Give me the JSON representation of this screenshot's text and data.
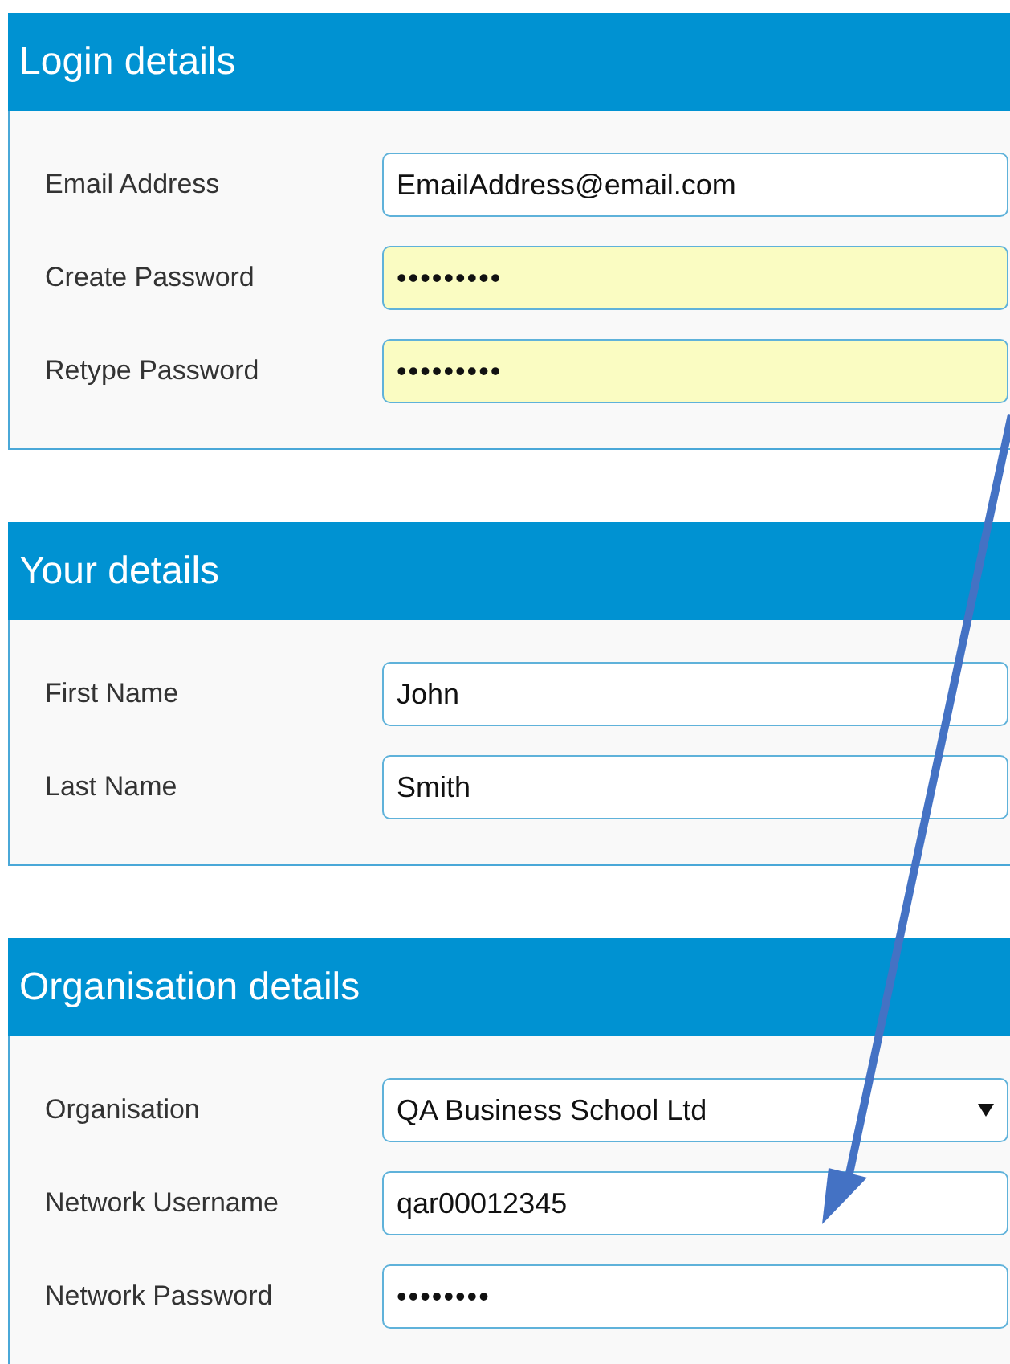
{
  "sections": [
    {
      "title": "Login details",
      "fields": [
        {
          "label": "Email Address",
          "kind": "text",
          "value": "EmailAddress@email.com",
          "autofilled": false
        },
        {
          "label": "Create Password",
          "kind": "password",
          "value": "•••••••••",
          "autofilled": true
        },
        {
          "label": "Retype Password",
          "kind": "password",
          "value": "•••••••••",
          "autofilled": true
        }
      ]
    },
    {
      "title": "Your details",
      "fields": [
        {
          "label": "First Name",
          "kind": "text",
          "value": "John",
          "autofilled": false
        },
        {
          "label": "Last Name",
          "kind": "text",
          "value": "Smith",
          "autofilled": false
        }
      ]
    },
    {
      "title": "Organisation details",
      "fields": [
        {
          "label": "Organisation",
          "kind": "select",
          "value": "QA Business School Ltd",
          "autofilled": false
        },
        {
          "label": "Network Username",
          "kind": "text",
          "value": "qar00012345",
          "autofilled": false
        },
        {
          "label": "Network Password",
          "kind": "password",
          "value": "••••••••",
          "autofilled": false
        }
      ]
    }
  ]
}
